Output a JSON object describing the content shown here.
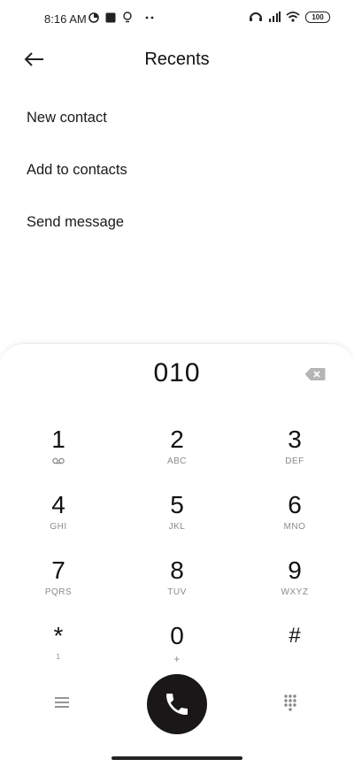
{
  "status_bar": {
    "time": "8:16 AM",
    "battery": "100",
    "icons": [
      "data-saver-icon",
      "square-app-icon",
      "bulb-icon",
      "more-dots-icon",
      "headset-icon",
      "signal-icon",
      "wifi-icon",
      "battery-icon"
    ]
  },
  "header": {
    "title": "Recents",
    "back_icon": "arrow-left-icon"
  },
  "menu": {
    "items": [
      {
        "label": "New contact"
      },
      {
        "label": "Add to contacts"
      },
      {
        "label": "Send message"
      }
    ]
  },
  "dialpad": {
    "number": "010",
    "keys": [
      {
        "digit": "1",
        "letters": ""
      },
      {
        "digit": "2",
        "letters": "ABC"
      },
      {
        "digit": "3",
        "letters": "DEF"
      },
      {
        "digit": "4",
        "letters": "GHI"
      },
      {
        "digit": "5",
        "letters": "JKL"
      },
      {
        "digit": "6",
        "letters": "MNO"
      },
      {
        "digit": "7",
        "letters": "PQRS"
      },
      {
        "digit": "8",
        "letters": "TUV"
      },
      {
        "digit": "9",
        "letters": "WXYZ"
      },
      {
        "digit": "*",
        "letters": "1"
      },
      {
        "digit": "0",
        "letters": "+"
      },
      {
        "digit": "#",
        "letters": ""
      }
    ]
  },
  "colors": {
    "call_button": "#1a1718",
    "sub_letters": "#8a8a8a"
  }
}
